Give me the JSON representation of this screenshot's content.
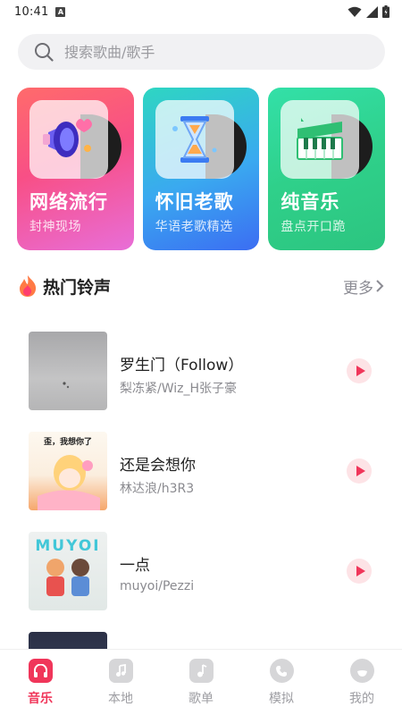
{
  "status_bar": {
    "time": "10:41",
    "notification_badge": "A"
  },
  "search": {
    "placeholder": "搜索歌曲/歌手"
  },
  "categories": [
    {
      "title": "网络流行",
      "subtitle": "封神现场",
      "icon": "megaphone-icon"
    },
    {
      "title": "怀旧老歌",
      "subtitle": "华语老歌精选",
      "icon": "hourglass-icon"
    },
    {
      "title": "纯音乐",
      "subtitle": "盘点开口跪",
      "icon": "piano-icon"
    }
  ],
  "section": {
    "title": "热门铃声",
    "more": "更多",
    "icon": "flame-icon"
  },
  "songs": [
    {
      "title": "罗生门（Follow）",
      "artist": "梨冻紧/Wiz_H张子豪"
    },
    {
      "title": "还是会想你",
      "artist": "林达浪/h3R3",
      "cover_text": "歪，我想你了"
    },
    {
      "title": "一点",
      "artist": "muyoi/Pezzi",
      "cover_text": "MUYOI"
    }
  ],
  "bottom_nav": [
    {
      "label": "音乐",
      "icon": "headphones-icon",
      "active": true
    },
    {
      "label": "本地",
      "icon": "local-music-icon",
      "active": false
    },
    {
      "label": "歌单",
      "icon": "playlist-icon",
      "active": false
    },
    {
      "label": "模拟",
      "icon": "phone-icon",
      "active": false
    },
    {
      "label": "我的",
      "icon": "profile-icon",
      "active": false
    }
  ],
  "colors": {
    "accent": "#f0365a",
    "card1": "#f84f86",
    "card2": "#3aa9f0",
    "card3": "#2fd08a"
  }
}
